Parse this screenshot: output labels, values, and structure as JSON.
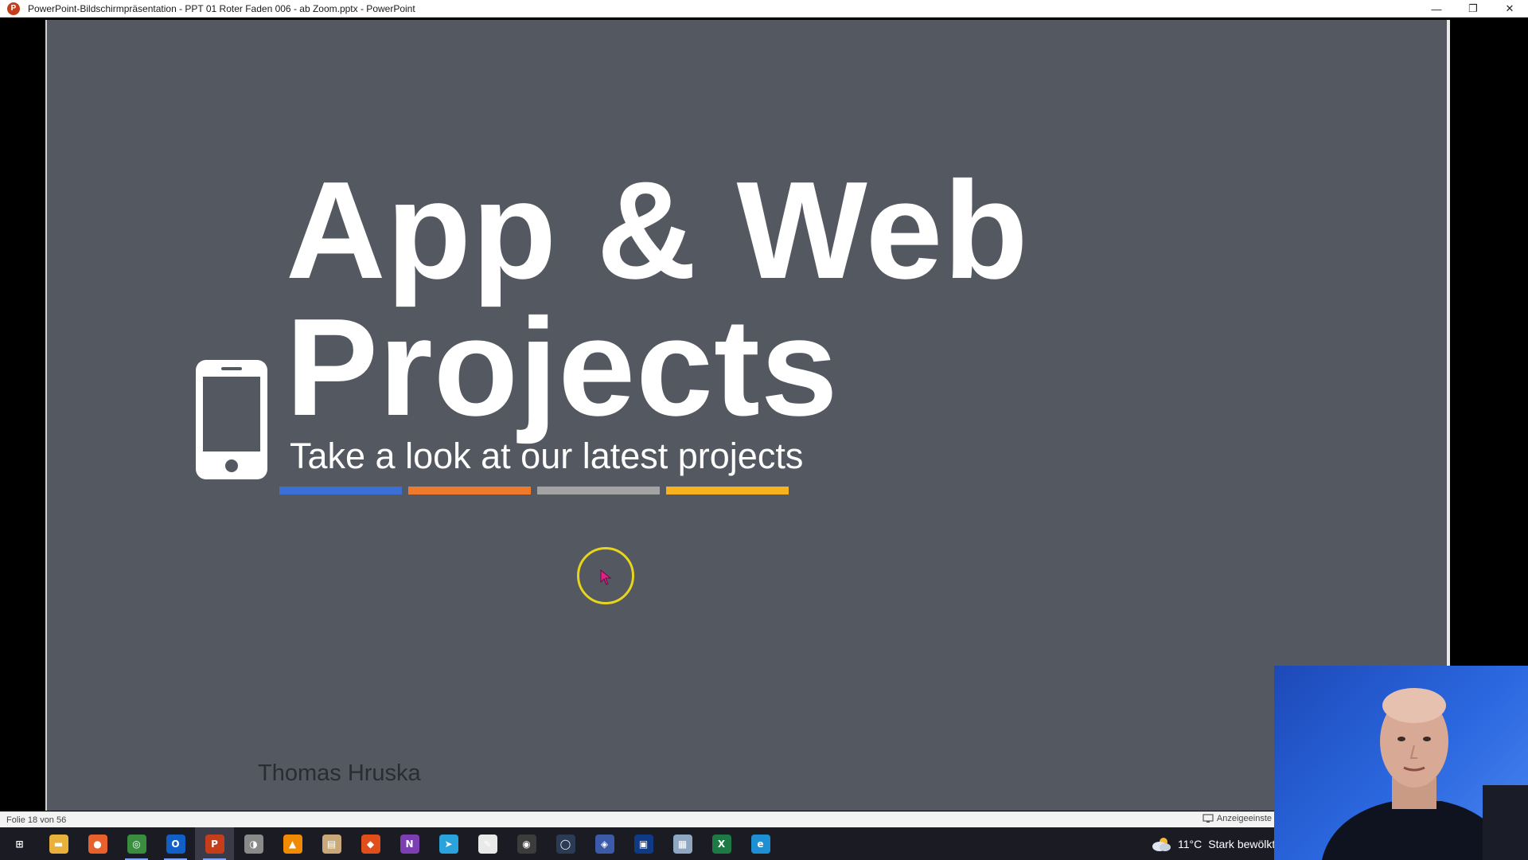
{
  "window": {
    "title": "PowerPoint-Bildschirmpräsentation  -  PPT 01 Roter Faden 006 - ab Zoom.pptx - PowerPoint",
    "app_icon_letter": "P",
    "minimize": "—",
    "restore": "❐",
    "close": "✕"
  },
  "slide": {
    "title_line1": "App & Web",
    "title_line2": "Projects",
    "subtitle": "Take a look at our latest projects",
    "presenter": "Thomas Hruska",
    "background_color": "#545861",
    "bar_colors": [
      "#3c6fd6",
      "#f07a2c",
      "#a3a3a3",
      "#f7b21c"
    ],
    "icon": "smartphone-icon"
  },
  "statusbar": {
    "slide_count": "Folie 18 von 56",
    "display_settings": "Anzeigeeinste"
  },
  "taskbar": {
    "icons": [
      {
        "name": "start-icon",
        "glyph": "⊞",
        "color": "#1b1b24"
      },
      {
        "name": "file-explorer-icon",
        "glyph": "▬",
        "color": "#e8b13c"
      },
      {
        "name": "firefox-icon",
        "glyph": "●",
        "color": "#e8602c"
      },
      {
        "name": "chrome-icon",
        "glyph": "◎",
        "color": "#3a8d3f"
      },
      {
        "name": "outlook-icon",
        "glyph": "O",
        "color": "#1160c8"
      },
      {
        "name": "powerpoint-icon",
        "glyph": "P",
        "color": "#c43e1c"
      },
      {
        "name": "app-icon-7",
        "glyph": "◑",
        "color": "#8a8a8a"
      },
      {
        "name": "vlc-icon",
        "glyph": "▲",
        "color": "#f08a00"
      },
      {
        "name": "notepad-icon",
        "glyph": "▤",
        "color": "#c9a97a"
      },
      {
        "name": "app-icon-10",
        "glyph": "◆",
        "color": "#e04e1b"
      },
      {
        "name": "onenote-icon",
        "glyph": "N",
        "color": "#7b3fb3"
      },
      {
        "name": "telegram-icon",
        "glyph": "➤",
        "color": "#2aa3dd"
      },
      {
        "name": "app-icon-13",
        "glyph": "✎",
        "color": "#e9e9e9"
      },
      {
        "name": "obs-icon",
        "glyph": "◉",
        "color": "#3c3c3c"
      },
      {
        "name": "app-icon-15",
        "glyph": "◯",
        "color": "#2b3a55"
      },
      {
        "name": "app-icon-16",
        "glyph": "◈",
        "color": "#3c5aa8"
      },
      {
        "name": "app-icon-17",
        "glyph": "▣",
        "color": "#0f3b86"
      },
      {
        "name": "app-icon-18",
        "glyph": "▦",
        "color": "#8fa7c0"
      },
      {
        "name": "excel-icon",
        "glyph": "X",
        "color": "#1d7a44"
      },
      {
        "name": "edge-icon",
        "glyph": "e",
        "color": "#1f8fd4"
      }
    ],
    "active_icon": "powerpoint-icon",
    "tray": {
      "weather_icon": "cloudy-weather-icon",
      "temperature": "11°C",
      "weather": "Stark bewölkt"
    }
  }
}
